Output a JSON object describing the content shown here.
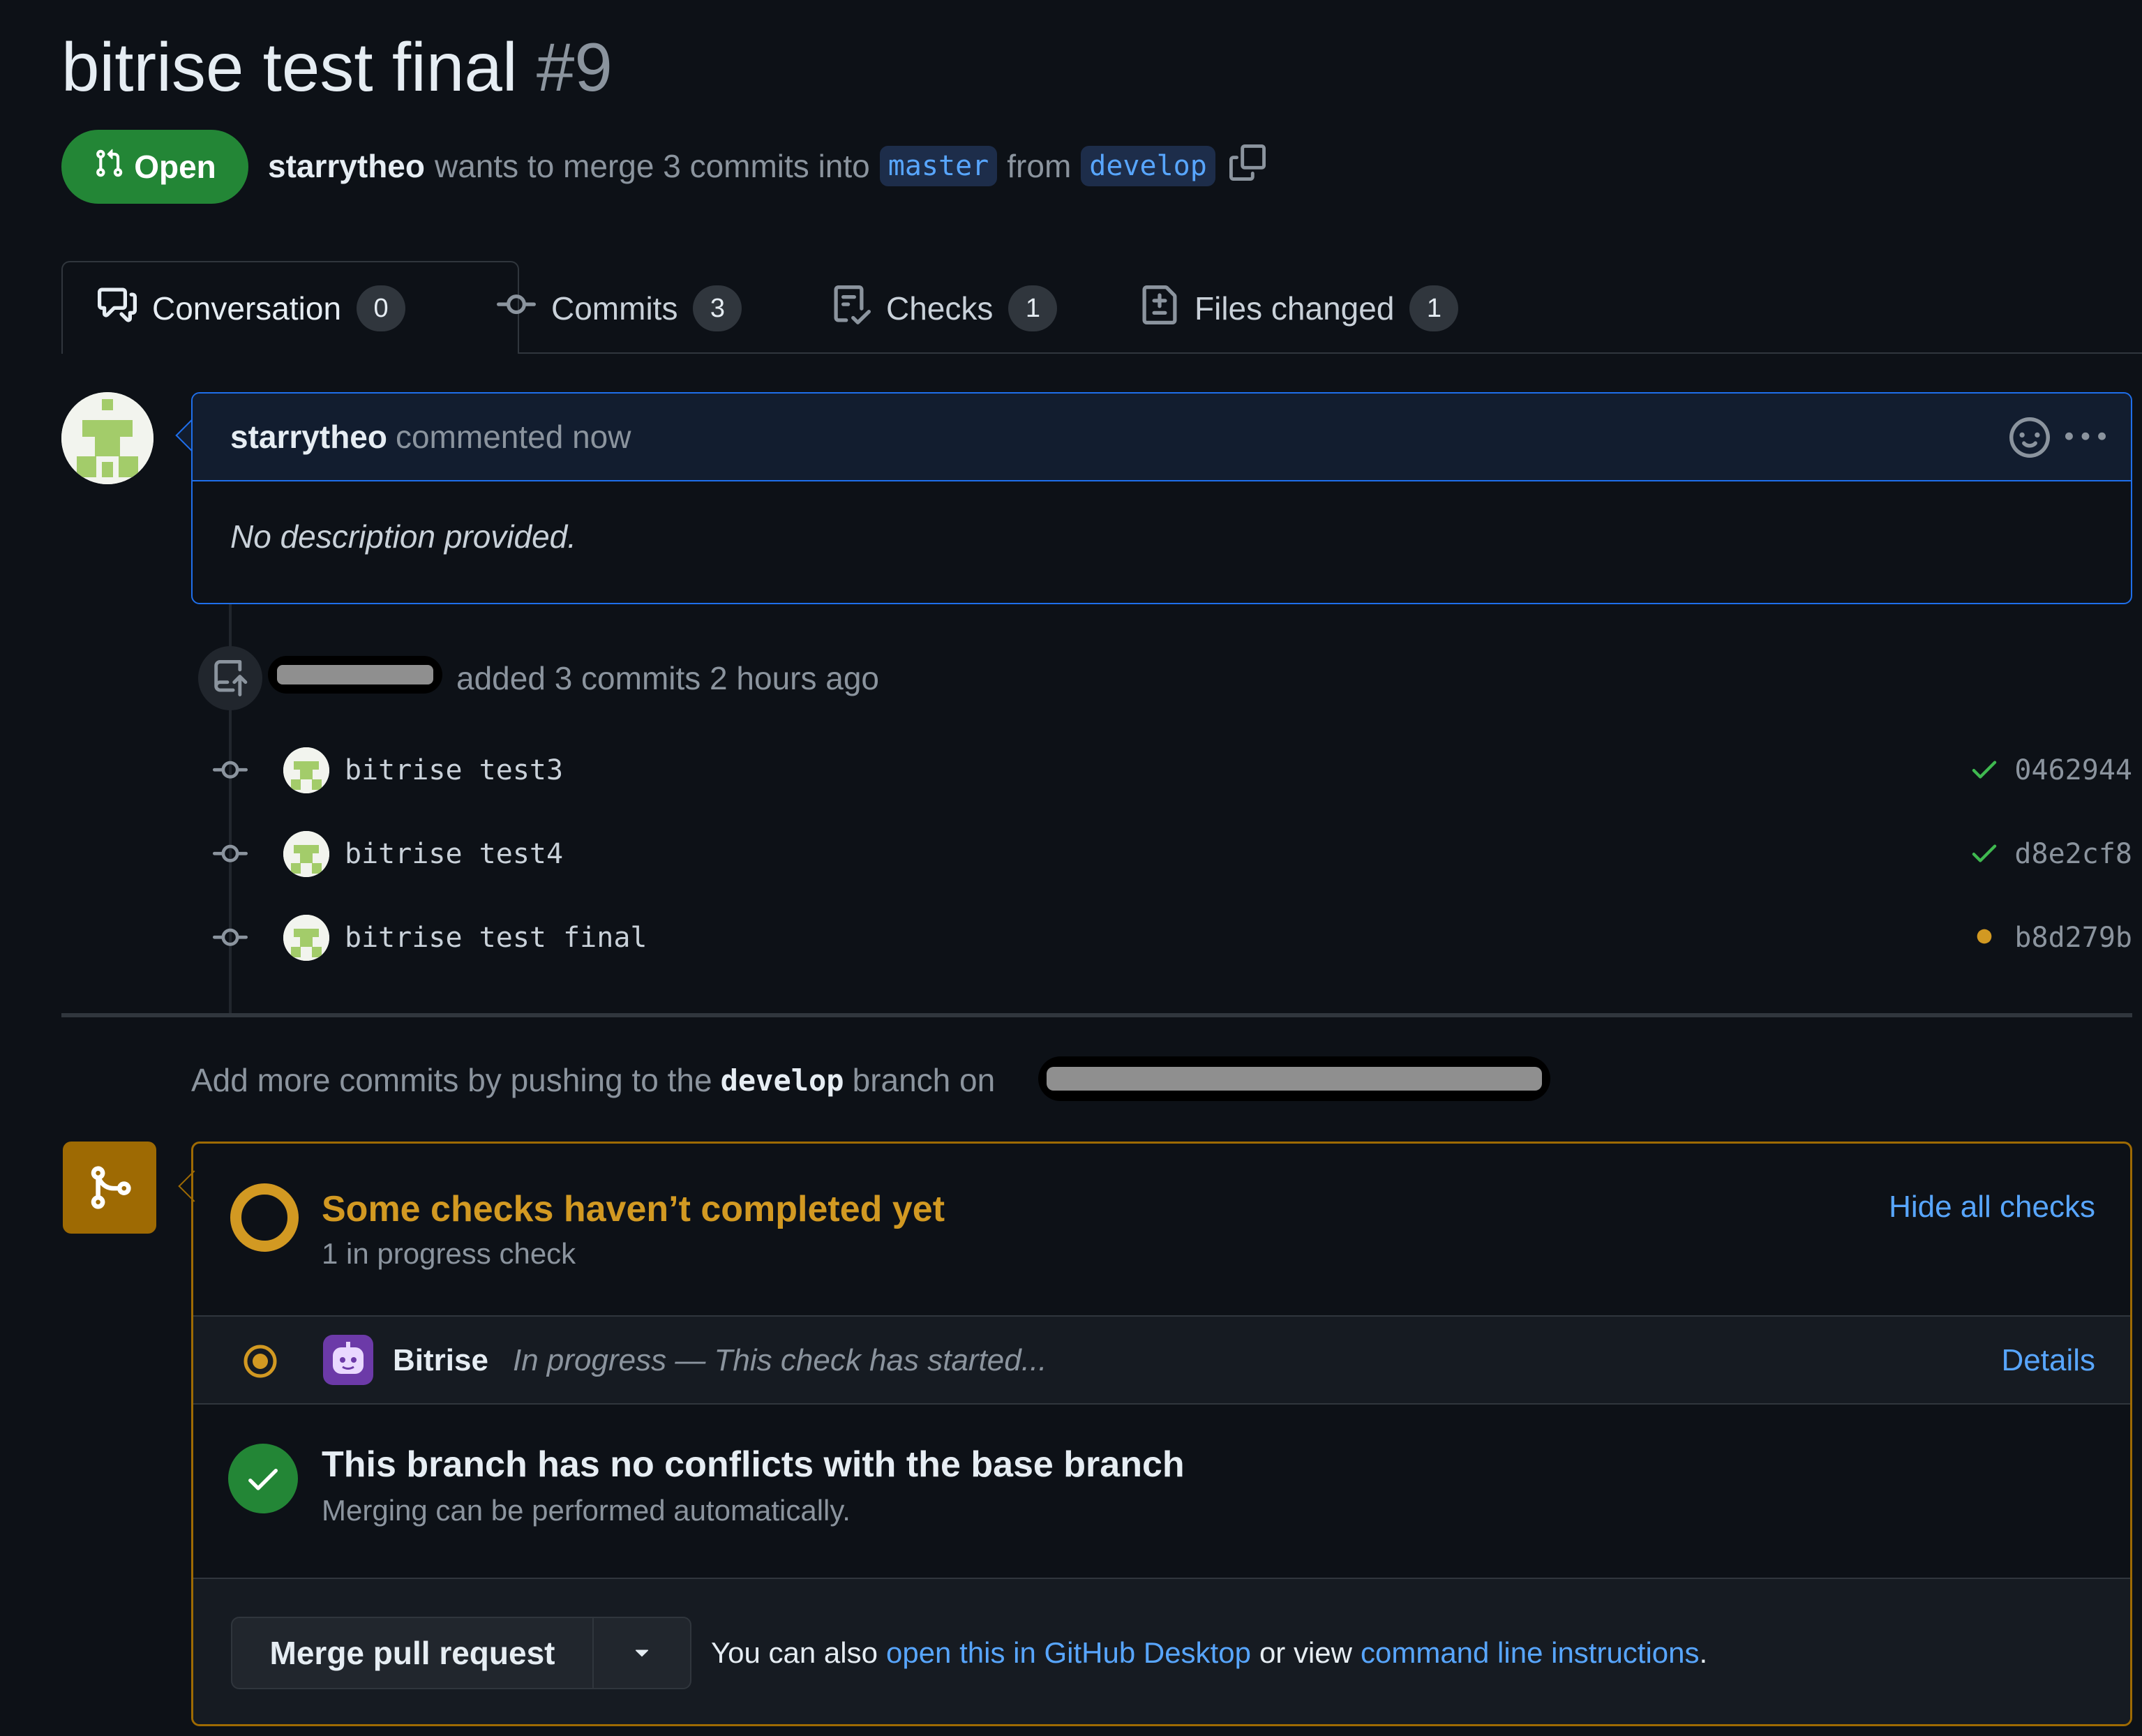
{
  "pr": {
    "title": "bitrise test final",
    "number": "#9",
    "state": "Open",
    "author": "starrytheo",
    "merge_text": "wants to merge 3 commits into",
    "base_branch": "master",
    "from_text": "from",
    "head_branch": "develop"
  },
  "tabs": [
    {
      "label": "Conversation",
      "count": "0",
      "icon": "comment-discussion-icon"
    },
    {
      "label": "Commits",
      "count": "3",
      "icon": "git-commit-icon"
    },
    {
      "label": "Checks",
      "count": "1",
      "icon": "checklist-icon"
    },
    {
      "label": "Files changed",
      "count": "1",
      "icon": "file-diff-icon"
    }
  ],
  "comment": {
    "author": "starrytheo",
    "meta": "commented now",
    "body": "No description provided."
  },
  "push_event": {
    "text": "added 3 commits 2 hours ago"
  },
  "commits": [
    {
      "message": "bitrise test3",
      "sha": "0462944",
      "status": "success"
    },
    {
      "message": "bitrise test4",
      "sha": "d8e2cf8",
      "status": "success"
    },
    {
      "message": "bitrise test final",
      "sha": "b8d279b",
      "status": "pending"
    }
  ],
  "push_more": {
    "prefix": "Add more commits by pushing to the",
    "branch": "develop",
    "suffix": "branch on"
  },
  "merge_box": {
    "checks_title": "Some checks haven’t completed yet",
    "checks_subtitle": "1 in progress check",
    "hide_checks": "Hide all checks",
    "check_name": "Bitrise",
    "check_status": "In progress — This check has started...",
    "details": "Details",
    "conflicts_title": "This branch has no conflicts with the base branch",
    "conflicts_subtitle": "Merging can be performed automatically.",
    "merge_button": "Merge pull request",
    "also_prefix": "You can also",
    "desktop_link": "open this in GitHub Desktop",
    "or_view": "or view",
    "cli_link": "command line instructions",
    "period": "."
  },
  "colors": {
    "open_green": "#238636",
    "pending_yellow": "#d29922",
    "link_blue": "#58a6ff",
    "background": "#0d1117"
  }
}
